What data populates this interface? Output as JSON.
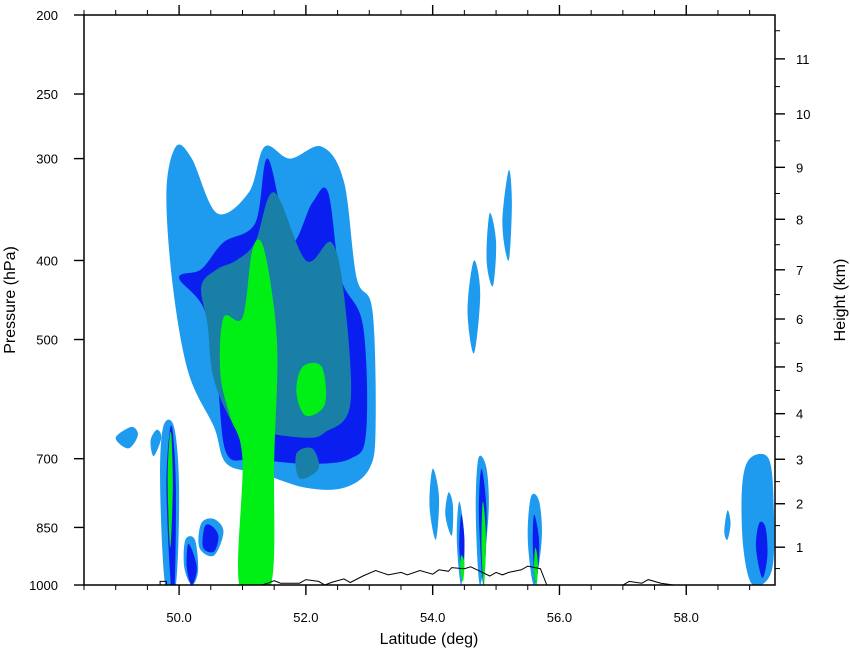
{
  "chart_data": {
    "type": "heatmap",
    "title": "",
    "xlabel": "Latitude (deg)",
    "ylabel": "Pressure (hPa)",
    "y2label": "Height (km)",
    "xlim": [
      48.5,
      59.4
    ],
    "x_ticks": [
      50.0,
      52.0,
      54.0,
      56.0,
      58.0
    ],
    "x_tick_labels": [
      "50.0",
      "52.0",
      "54.0",
      "56.0",
      "58.0"
    ],
    "y_scale": "log",
    "ylim": [
      1000,
      200
    ],
    "y_ticks": [
      1000,
      850,
      700,
      500,
      400,
      300,
      250,
      200
    ],
    "y_tick_labels": [
      "1000",
      "850",
      "700",
      "500",
      "400",
      "300",
      "250",
      "200"
    ],
    "y2_ticks": [
      1,
      2,
      3,
      4,
      5,
      6,
      7,
      8,
      9,
      10,
      11
    ],
    "y2_tick_labels": [
      "1",
      "2",
      "3",
      "4",
      "5",
      "6",
      "7",
      "8",
      "9",
      "10",
      "11"
    ],
    "contour_levels": [
      {
        "level": 1,
        "color": "#1e9bef"
      },
      {
        "level": 2,
        "color": "#0a1ef0"
      },
      {
        "level": 3,
        "color": "#1a7fa6"
      },
      {
        "level": 4,
        "color": "#00f016"
      }
    ],
    "regions": [
      {
        "level": 1,
        "points": [
          [
            49.25,
            640
          ],
          [
            49.0,
            660
          ],
          [
            49.2,
            680
          ],
          [
            49.35,
            655
          ]
        ]
      },
      {
        "level": 1,
        "points": [
          [
            49.65,
            645
          ],
          [
            49.55,
            665
          ],
          [
            49.6,
            695
          ],
          [
            49.72,
            660
          ]
        ]
      },
      {
        "level": 1,
        "points": [
          [
            49.95,
            290
          ],
          [
            49.8,
            330
          ],
          [
            49.9,
            430
          ],
          [
            50.15,
            550
          ],
          [
            50.55,
            640
          ],
          [
            50.75,
            710
          ],
          [
            51.3,
            730
          ],
          [
            52.0,
            760
          ],
          [
            52.6,
            760
          ],
          [
            53.0,
            720
          ],
          [
            53.1,
            640
          ],
          [
            53.05,
            460
          ],
          [
            52.8,
            420
          ],
          [
            52.6,
            320
          ],
          [
            52.25,
            290
          ],
          [
            51.75,
            300
          ],
          [
            51.35,
            290
          ],
          [
            51.1,
            330
          ],
          [
            50.6,
            350
          ],
          [
            50.2,
            300
          ]
        ]
      },
      {
        "level": 1,
        "points": [
          [
            54.65,
            400
          ],
          [
            54.55,
            460
          ],
          [
            54.65,
            520
          ],
          [
            54.75,
            440
          ]
        ]
      },
      {
        "level": 1,
        "points": [
          [
            54.9,
            350
          ],
          [
            54.85,
            400
          ],
          [
            54.95,
            430
          ],
          [
            55.0,
            380
          ]
        ]
      },
      {
        "level": 1,
        "points": [
          [
            55.2,
            310
          ],
          [
            55.1,
            360
          ],
          [
            55.2,
            400
          ],
          [
            55.25,
            340
          ]
        ]
      },
      {
        "level": 1,
        "points": [
          [
            54.0,
            720
          ],
          [
            53.95,
            800
          ],
          [
            54.05,
            880
          ],
          [
            54.1,
            780
          ]
        ]
      },
      {
        "level": 1,
        "points": [
          [
            54.25,
            770
          ],
          [
            54.2,
            820
          ],
          [
            54.3,
            870
          ],
          [
            54.32,
            800
          ]
        ]
      },
      {
        "level": 1,
        "points": [
          [
            54.42,
            790
          ],
          [
            54.38,
            880
          ],
          [
            54.45,
            1000
          ],
          [
            54.5,
            880
          ]
        ]
      },
      {
        "level": 1,
        "points": [
          [
            54.72,
            700
          ],
          [
            54.68,
            820
          ],
          [
            54.75,
            1000
          ],
          [
            54.88,
            820
          ],
          [
            54.85,
            720
          ]
        ]
      },
      {
        "level": 1,
        "points": [
          [
            55.55,
            780
          ],
          [
            55.5,
            880
          ],
          [
            55.6,
            1000
          ],
          [
            55.72,
            880
          ],
          [
            55.68,
            790
          ]
        ]
      },
      {
        "level": 1,
        "points": [
          [
            59.0,
            700
          ],
          [
            58.88,
            760
          ],
          [
            58.9,
            900
          ],
          [
            59.05,
            1000
          ],
          [
            59.35,
            960
          ],
          [
            59.38,
            800
          ],
          [
            59.3,
            700
          ]
        ]
      },
      {
        "level": 1,
        "points": [
          [
            58.65,
            810
          ],
          [
            58.6,
            860
          ],
          [
            58.65,
            880
          ],
          [
            58.7,
            840
          ]
        ]
      },
      {
        "level": 1,
        "points": [
          [
            49.75,
            640
          ],
          [
            49.7,
            750
          ],
          [
            49.78,
            1000
          ],
          [
            49.95,
            1000
          ],
          [
            50.0,
            760
          ],
          [
            49.92,
            640
          ]
        ]
      },
      {
        "level": 1,
        "points": [
          [
            50.1,
            880
          ],
          [
            50.08,
            950
          ],
          [
            50.2,
            1000
          ],
          [
            50.3,
            960
          ],
          [
            50.25,
            880
          ]
        ]
      },
      {
        "level": 1,
        "points": [
          [
            50.35,
            840
          ],
          [
            50.32,
            900
          ],
          [
            50.55,
            920
          ],
          [
            50.7,
            860
          ],
          [
            50.55,
            830
          ]
        ]
      },
      {
        "level": 2,
        "points": [
          [
            49.85,
            650
          ],
          [
            49.8,
            760
          ],
          [
            49.87,
            1000
          ],
          [
            49.93,
            1000
          ],
          [
            49.95,
            760
          ],
          [
            49.9,
            650
          ]
        ]
      },
      {
        "level": 2,
        "points": [
          [
            50.15,
            890
          ],
          [
            50.12,
            950
          ],
          [
            50.2,
            1000
          ],
          [
            50.28,
            950
          ]
        ]
      },
      {
        "level": 2,
        "points": [
          [
            50.4,
            850
          ],
          [
            50.38,
            900
          ],
          [
            50.55,
            910
          ],
          [
            50.62,
            870
          ],
          [
            50.5,
            845
          ]
        ]
      },
      {
        "level": 2,
        "points": [
          [
            50.0,
            420
          ],
          [
            50.4,
            460
          ],
          [
            50.6,
            560
          ],
          [
            50.75,
            690
          ],
          [
            51.2,
            700
          ],
          [
            52.0,
            710
          ],
          [
            52.7,
            700
          ],
          [
            52.95,
            650
          ],
          [
            52.9,
            480
          ],
          [
            52.55,
            420
          ],
          [
            52.35,
            330
          ],
          [
            52.1,
            340
          ],
          [
            51.75,
            380
          ],
          [
            51.4,
            300
          ],
          [
            51.2,
            360
          ],
          [
            50.7,
            380
          ],
          [
            50.35,
            410
          ]
        ]
      },
      {
        "level": 2,
        "points": [
          [
            54.45,
            820
          ],
          [
            54.42,
            900
          ],
          [
            54.48,
            980
          ],
          [
            54.5,
            880
          ]
        ]
      },
      {
        "level": 2,
        "points": [
          [
            54.77,
            720
          ],
          [
            54.73,
            820
          ],
          [
            54.8,
            1000
          ],
          [
            54.85,
            820
          ]
        ]
      },
      {
        "level": 2,
        "points": [
          [
            55.6,
            820
          ],
          [
            55.58,
            900
          ],
          [
            55.63,
            1000
          ],
          [
            55.68,
            890
          ]
        ]
      },
      {
        "level": 2,
        "points": [
          [
            59.15,
            840
          ],
          [
            59.1,
            900
          ],
          [
            59.2,
            980
          ],
          [
            59.28,
            920
          ],
          [
            59.25,
            850
          ]
        ]
      },
      {
        "level": 3,
        "points": [
          [
            50.35,
            430
          ],
          [
            50.45,
            480
          ],
          [
            50.55,
            560
          ],
          [
            50.9,
            640
          ],
          [
            51.3,
            650
          ],
          [
            52.0,
            660
          ],
          [
            52.3,
            650
          ],
          [
            52.7,
            600
          ],
          [
            52.6,
            440
          ],
          [
            52.4,
            380
          ],
          [
            52.0,
            400
          ],
          [
            51.5,
            330
          ],
          [
            51.2,
            380
          ],
          [
            50.9,
            400
          ],
          [
            50.6,
            410
          ]
        ]
      },
      {
        "level": 3,
        "points": [
          [
            51.85,
            690
          ],
          [
            51.9,
            740
          ],
          [
            52.2,
            720
          ],
          [
            52.1,
            680
          ]
        ]
      },
      {
        "level": 4,
        "points": [
          [
            51.15,
            390
          ],
          [
            51.0,
            470
          ],
          [
            50.7,
            470
          ],
          [
            50.65,
            550
          ],
          [
            50.8,
            620
          ],
          [
            51.0,
            700
          ],
          [
            50.95,
            1000
          ],
          [
            51.45,
            1000
          ],
          [
            51.5,
            700
          ],
          [
            51.55,
            520
          ],
          [
            51.45,
            430
          ],
          [
            51.3,
            380
          ]
        ]
      },
      {
        "level": 4,
        "points": [
          [
            51.95,
            540
          ],
          [
            51.85,
            580
          ],
          [
            52.0,
            620
          ],
          [
            52.3,
            600
          ],
          [
            52.25,
            540
          ]
        ]
      },
      {
        "level": 4,
        "points": [
          [
            49.85,
            660
          ],
          [
            49.82,
            750
          ],
          [
            49.86,
            900
          ],
          [
            49.9,
            760
          ],
          [
            49.88,
            660
          ]
        ]
      },
      {
        "level": 4,
        "points": [
          [
            54.45,
            920
          ],
          [
            54.44,
            960
          ],
          [
            54.48,
            990
          ],
          [
            54.5,
            940
          ]
        ]
      },
      {
        "level": 4,
        "points": [
          [
            54.79,
            790
          ],
          [
            54.77,
            900
          ],
          [
            54.81,
            1000
          ],
          [
            54.84,
            870
          ]
        ]
      },
      {
        "level": 4,
        "points": [
          [
            55.62,
            900
          ],
          [
            55.6,
            960
          ],
          [
            55.64,
            1000
          ],
          [
            55.66,
            940
          ]
        ]
      }
    ],
    "terrain": [
      [
        48.5,
        1000
      ],
      [
        49.7,
        1000
      ],
      [
        49.7,
        990
      ],
      [
        49.8,
        990
      ],
      [
        49.8,
        1000
      ],
      [
        51.3,
        1000
      ],
      [
        51.4,
        995
      ],
      [
        51.5,
        988
      ],
      [
        51.6,
        995
      ],
      [
        51.9,
        995
      ],
      [
        52.0,
        985
      ],
      [
        52.2,
        990
      ],
      [
        52.3,
        1000
      ],
      [
        52.4,
        993
      ],
      [
        52.6,
        983
      ],
      [
        52.7,
        993
      ],
      [
        52.9,
        975
      ],
      [
        53.1,
        960
      ],
      [
        53.3,
        972
      ],
      [
        53.5,
        965
      ],
      [
        53.6,
        972
      ],
      [
        53.8,
        960
      ],
      [
        54.0,
        970
      ],
      [
        54.1,
        958
      ],
      [
        54.25,
        962
      ],
      [
        54.3,
        952
      ],
      [
        54.5,
        955
      ],
      [
        54.6,
        950
      ],
      [
        54.75,
        962
      ],
      [
        54.9,
        975
      ],
      [
        55.0,
        965
      ],
      [
        55.1,
        972
      ],
      [
        55.2,
        965
      ],
      [
        55.4,
        958
      ],
      [
        55.5,
        948
      ],
      [
        55.7,
        955
      ],
      [
        55.8,
        1000
      ],
      [
        57.0,
        1000
      ],
      [
        57.1,
        990
      ],
      [
        57.3,
        995
      ],
      [
        57.4,
        985
      ],
      [
        57.6,
        995
      ],
      [
        57.8,
        1000
      ],
      [
        59.4,
        1000
      ]
    ]
  }
}
